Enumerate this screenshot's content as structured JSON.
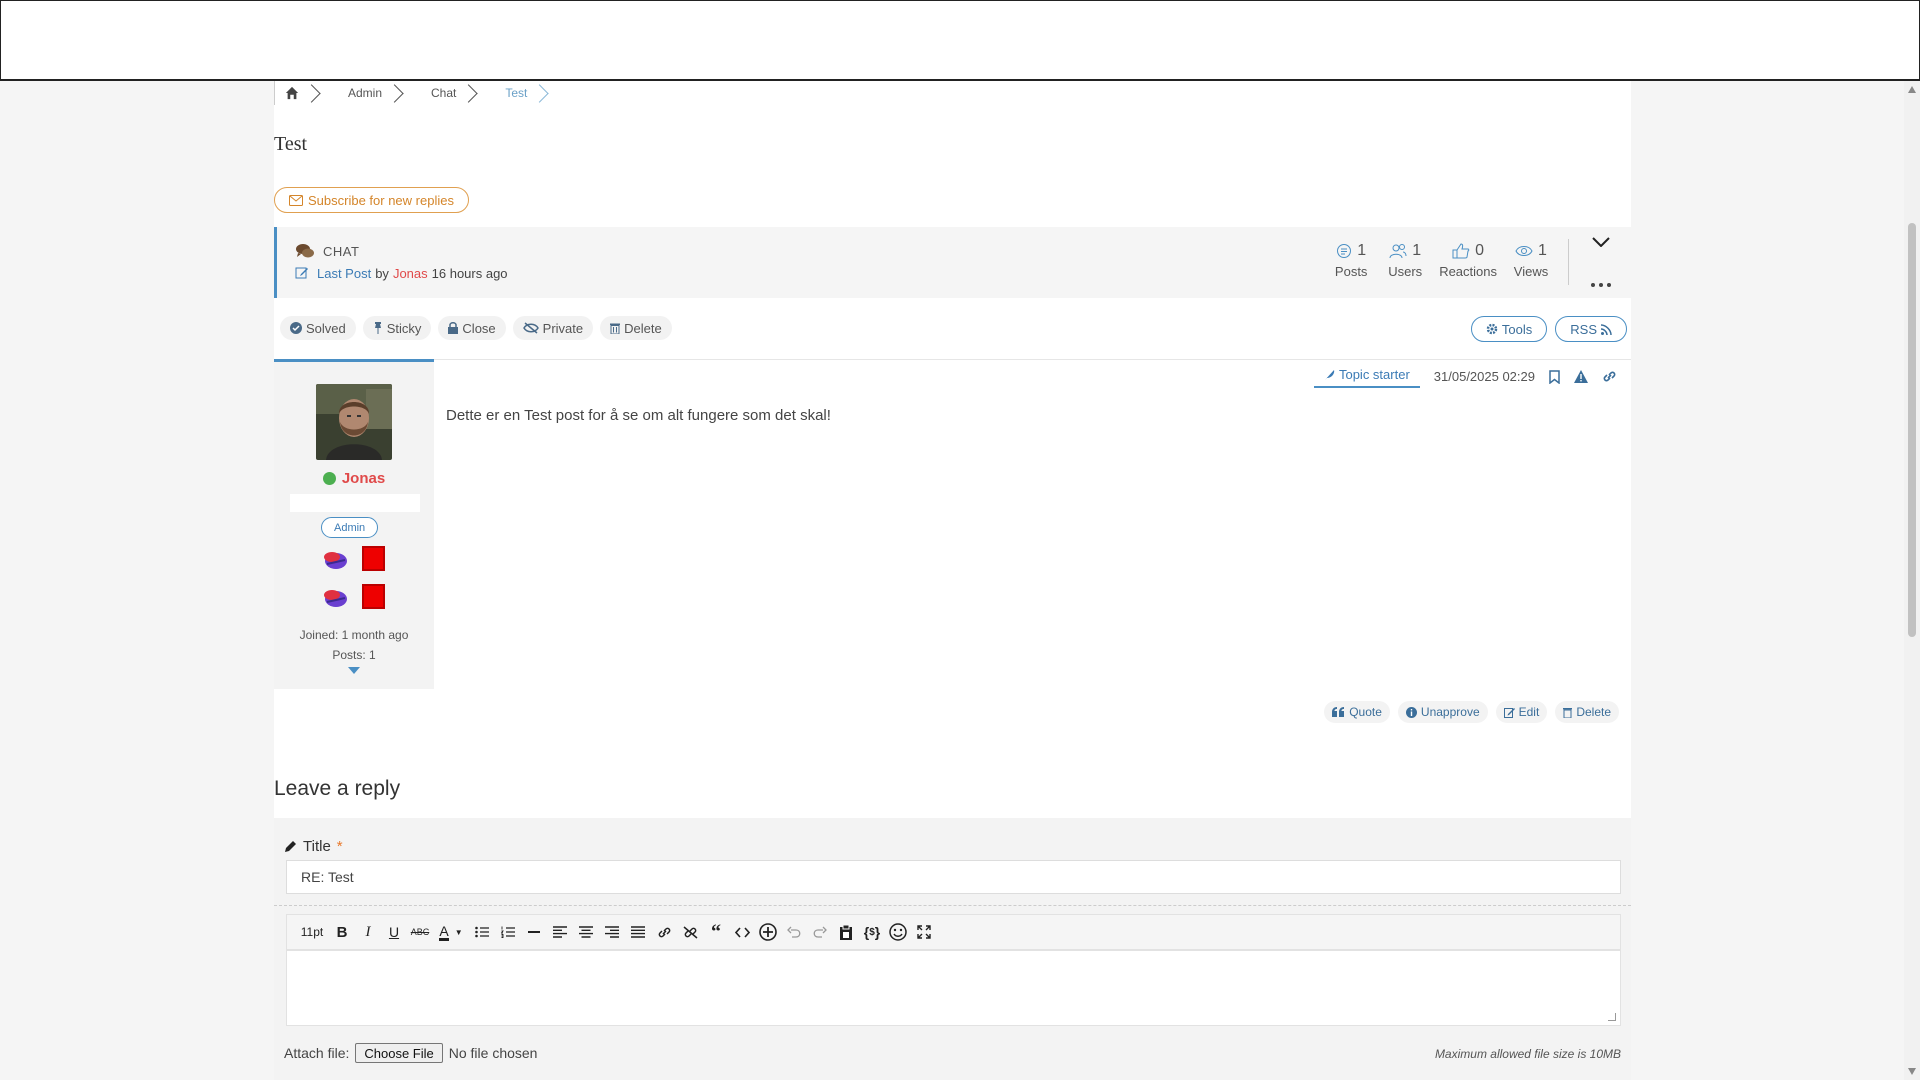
{
  "breadcrumb": {
    "items": [
      "Admin",
      "Chat",
      "Test"
    ]
  },
  "topic": {
    "title": "Test"
  },
  "subscribe_label": "Subscribe for new replies",
  "info": {
    "category": "CHAT",
    "last_post_label": "Last Post",
    "by": "by",
    "last_user": "Jonas",
    "last_time": "16 hours ago",
    "stats": [
      {
        "value": "1",
        "label": "Posts"
      },
      {
        "value": "1",
        "label": "Users"
      },
      {
        "value": "0",
        "label": "Reactions"
      },
      {
        "value": "1",
        "label": "Views"
      }
    ]
  },
  "topic_actions": [
    "Solved",
    "Sticky",
    "Close",
    "Private",
    "Delete"
  ],
  "tools_label": "Tools",
  "rss_label": "RSS",
  "post": {
    "author": "Jonas",
    "role": "Admin",
    "joined": "Joined: 1 month ago",
    "posts": "Posts: 1",
    "starter_label": "Topic starter",
    "date": "31/05/2025 02:29",
    "body": "Dette er en Test post for å se om alt fungere som det skal!",
    "actions": [
      "Quote",
      "Unapprove",
      "Edit",
      "Delete"
    ]
  },
  "reply": {
    "heading": "Leave a reply",
    "title_label": "Title",
    "required_mark": "*",
    "title_value": "RE: Test",
    "font_size": "11pt",
    "attach_label": "Attach file:",
    "choose_file": "Choose File",
    "no_file": "No file chosen",
    "max_size": "Maximum allowed file size is 10MB"
  },
  "colors": {
    "accent": "#4a8fc4",
    "user": "#e04a4a",
    "subscribe": "#d4852a"
  }
}
